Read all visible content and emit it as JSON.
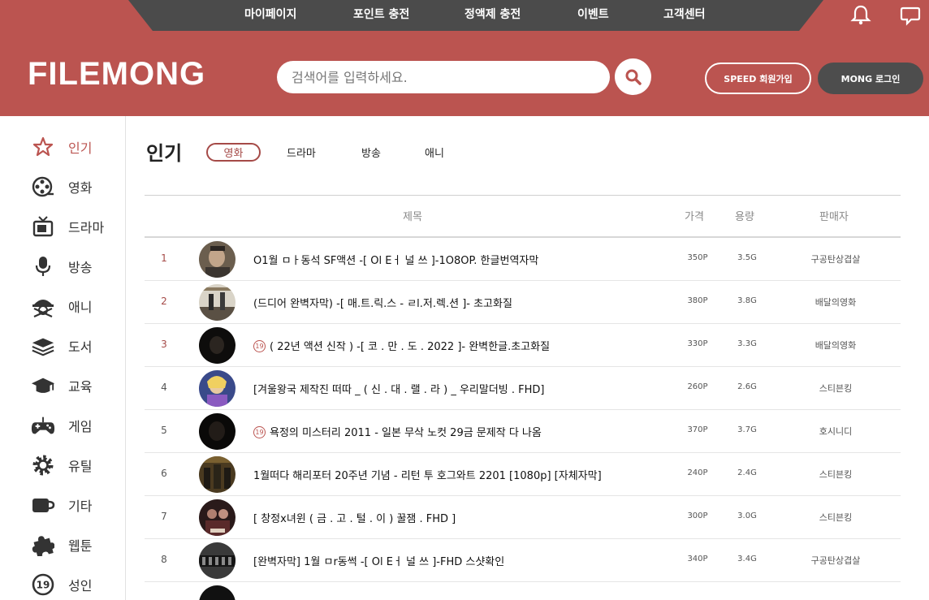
{
  "topnav": {
    "items": [
      "마이페이지",
      "포인트 충전",
      "정액제 충전",
      "이벤트",
      "고객센터"
    ]
  },
  "header": {
    "logo": "FILEMONG",
    "search_placeholder": "검색어를 입력하세요.",
    "signup_label": "SPEED 회원가입",
    "login_label": "MONG 로그인"
  },
  "sidebar": {
    "items": [
      {
        "label": "인기",
        "icon": "star-icon"
      },
      {
        "label": "영화",
        "icon": "film-reel-icon"
      },
      {
        "label": "드라마",
        "icon": "tv-icon"
      },
      {
        "label": "방송",
        "icon": "microphone-icon"
      },
      {
        "label": "애니",
        "icon": "pirate-icon"
      },
      {
        "label": "도서",
        "icon": "books-icon"
      },
      {
        "label": "교육",
        "icon": "graduation-cap-icon"
      },
      {
        "label": "게임",
        "icon": "gamepad-icon"
      },
      {
        "label": "유틸",
        "icon": "gear-icon"
      },
      {
        "label": "기타",
        "icon": "cup-icon"
      },
      {
        "label": "웹툰",
        "icon": "puzzle-icon"
      },
      {
        "label": "성인",
        "icon": "adult-19-icon"
      }
    ]
  },
  "main": {
    "title": "인기",
    "tabs": [
      "영화",
      "드라마",
      "방송",
      "애니"
    ],
    "columns": {
      "title": "제목",
      "price": "가격",
      "size": "용량",
      "seller": "판매자"
    },
    "accent_color": "#bb5450",
    "rows": [
      {
        "rank": "1",
        "title": "O1월 ㅁㅏ동석 SF액션 -[ Ol Eㅓ 널 쓰 ]-1O8OP. 한글번역자막",
        "price": "350P",
        "size": "3.5G",
        "seller": "구공탄상겹살",
        "adult": false
      },
      {
        "rank": "2",
        "title": "(드디어 완벽자막) -[ 매.트.릭.스 - ㄹl.저.렉.션 ]- 초고화질",
        "price": "380P",
        "size": "3.8G",
        "seller": "배달의영화",
        "adult": false
      },
      {
        "rank": "3",
        "title": "( 22년 액션 신작 ) -[ 코 . 만 . 도 . 2022 ]- 완벽한글.초고화질",
        "price": "330P",
        "size": "3.3G",
        "seller": "배달의영화",
        "adult": true
      },
      {
        "rank": "4",
        "title": "[겨울왕국 제작진 떠따 _ ( 신 . 대 . 랠 . 라 ) _ 우리말더빙 . FHD]",
        "price": "260P",
        "size": "2.6G",
        "seller": "스티븐킹",
        "adult": false
      },
      {
        "rank": "5",
        "title": "욕정의 미스터리 2011 - 일본 무삭 노컷 29금 문제작 다 나옴",
        "price": "370P",
        "size": "3.7G",
        "seller": "호시니디",
        "adult": true
      },
      {
        "rank": "6",
        "title": "1월떠다 해리포터 20주년 기념 - 리턴 투 호그와트 2201 [1080p] [자체자막]",
        "price": "240P",
        "size": "2.4G",
        "seller": "스티븐킹",
        "adult": false
      },
      {
        "rank": "7",
        "title": "[ 창정x녀윈 ( 금 . 고 . 털 . 이 ) 꿀잼 . FHD ]",
        "price": "300P",
        "size": "3.0G",
        "seller": "스티븐킹",
        "adult": false
      },
      {
        "rank": "8",
        "title": "[완벽자막] 1월 ㅁr동썩 -[ Ol Eㅓ 널 쓰 ]-FHD 스샷확인",
        "price": "340P",
        "size": "3.4G",
        "seller": "구공탄상겹살",
        "adult": false
      }
    ]
  }
}
